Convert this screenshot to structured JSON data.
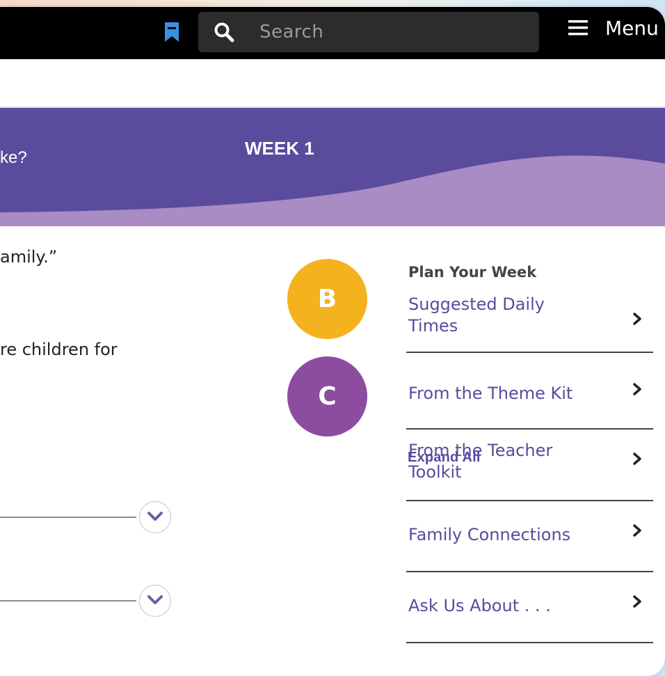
{
  "header": {
    "search_placeholder": "Search",
    "menu_label": "Menu"
  },
  "banner": {
    "question_tail": "ke?",
    "week_label": "WEEK 1",
    "colors": {
      "dark": "#5a4b9c",
      "light": "#a98cc4"
    }
  },
  "content": {
    "line1": "amily.”",
    "line2": "re children for",
    "expand_all": "Expand All"
  },
  "badges": [
    {
      "letter": "B",
      "color": "#f4b21e"
    },
    {
      "letter": "C",
      "color": "#8c4ca0"
    }
  ],
  "plan": {
    "title": "Plan Your Week",
    "items": [
      {
        "label_lines": [
          "Suggested Daily",
          "Times"
        ]
      },
      {
        "label_lines": [
          "From the Theme Kit"
        ]
      },
      {
        "label_lines": [
          "From the Teacher",
          "Toolkit"
        ]
      },
      {
        "label_lines": [
          "Family Connections"
        ]
      },
      {
        "label_lines": [
          "Ask Us About . . ."
        ]
      }
    ]
  },
  "icons": {
    "bookmark": "bookmark-icon",
    "search": "search-icon",
    "menu": "hamburger-menu-icon",
    "chevron_right": "chevron-right-icon",
    "chevron_down": "chevron-down-icon"
  }
}
